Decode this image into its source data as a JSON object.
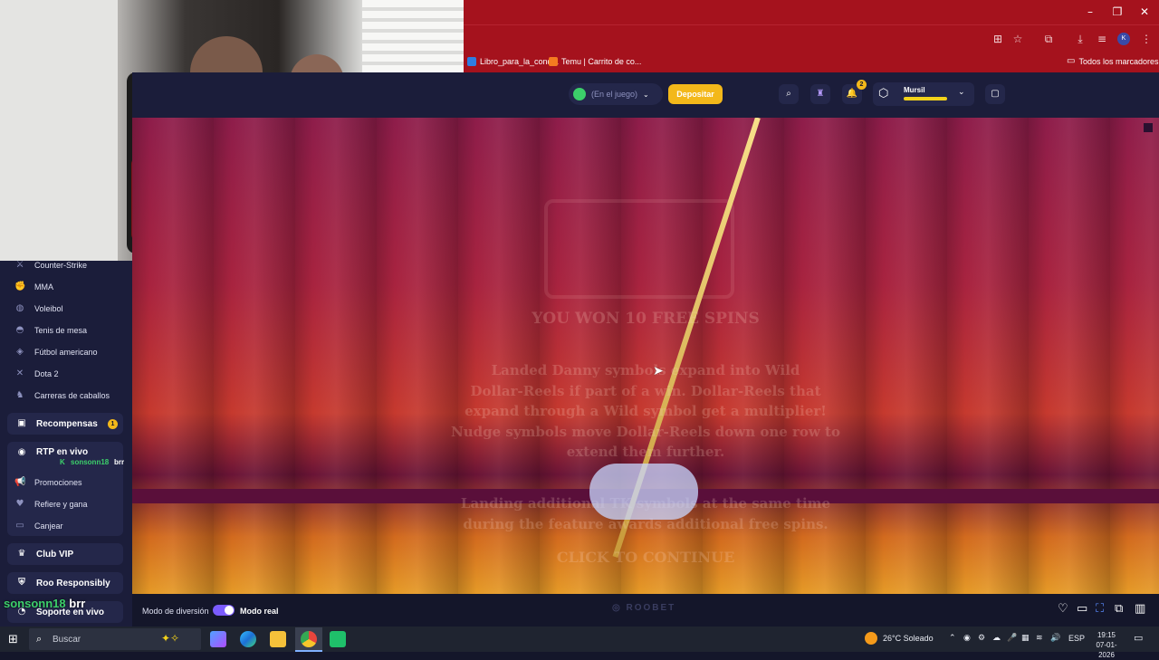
{
  "browser": {
    "bookmarks": [
      {
        "label": "Libro_para_la_cond...",
        "color": "#2f7de1"
      },
      {
        "label": "Temu | Carrito de co...",
        "color": "#f47b20"
      }
    ],
    "all_bookmarks_label": "Todos los marcadores",
    "profile_initial": "K"
  },
  "header": {
    "balance_placeholder": "(En el juego)",
    "deposit_label": "Depositar",
    "notification_count": "2",
    "username": "Mursil"
  },
  "sidebar": {
    "items": [
      {
        "label": "Counter-Strike",
        "icon": "counter-strike-icon",
        "glyph": "⚔"
      },
      {
        "label": "MMA",
        "icon": "mma-icon",
        "glyph": "✊"
      },
      {
        "label": "Voleibol",
        "icon": "volleyball-icon",
        "glyph": "◍"
      },
      {
        "label": "Tenis de mesa",
        "icon": "table-tennis-icon",
        "glyph": "◓"
      },
      {
        "label": "Fútbol americano",
        "icon": "american-football-icon",
        "glyph": "◈"
      },
      {
        "label": "Dota 2",
        "icon": "dota-icon",
        "glyph": "✕"
      },
      {
        "label": "Carreras de caballos",
        "icon": "horse-racing-icon",
        "glyph": "♞"
      }
    ],
    "rewards_label": "Recompensas",
    "rewards_badge": "1",
    "rtp_label": "RTP en vivo",
    "rtp_sub": "sonsonn18",
    "rtp_sub_extra": "brr",
    "sub_items": [
      {
        "label": "Promociones",
        "icon": "megaphone-icon",
        "glyph": "📢"
      },
      {
        "label": "Refiere y gana",
        "icon": "refer-icon",
        "glyph": "♥"
      },
      {
        "label": "Canjear",
        "icon": "redeem-icon",
        "glyph": "▭"
      }
    ],
    "vip_label": "Club VIP",
    "responsibly_label": "Roo Responsibly",
    "support_label": "Soporte en vivo"
  },
  "overlay": {
    "streamer_name": "sonsonn18",
    "streamer_suffix": "brr"
  },
  "game": {
    "title_line": "YOU WON 10 FREE SPINS",
    "body_lines": [
      "Landed Danny symbols expand into Wild",
      "Dollar-Reels if part of a win. Dollar-Reels that",
      "expand through a Wild symbol get a multiplier!",
      "Nudge symbols move Dollar-Reels down one row to",
      "extend them further."
    ],
    "extra_lines": [
      "Landing additional TK symbols at the same time",
      "during the feature awards additional free spins."
    ],
    "continue_label": "CLICK TO CONTINUE"
  },
  "footer": {
    "fun_mode_label": "Modo de diversión",
    "real_mode_label": "Modo real",
    "brand": "ROOBET"
  },
  "taskbar": {
    "search_placeholder": "Buscar",
    "weather": "26°C Soleado",
    "language": "ESP",
    "time": "19:15",
    "date": "07-01-2026"
  }
}
